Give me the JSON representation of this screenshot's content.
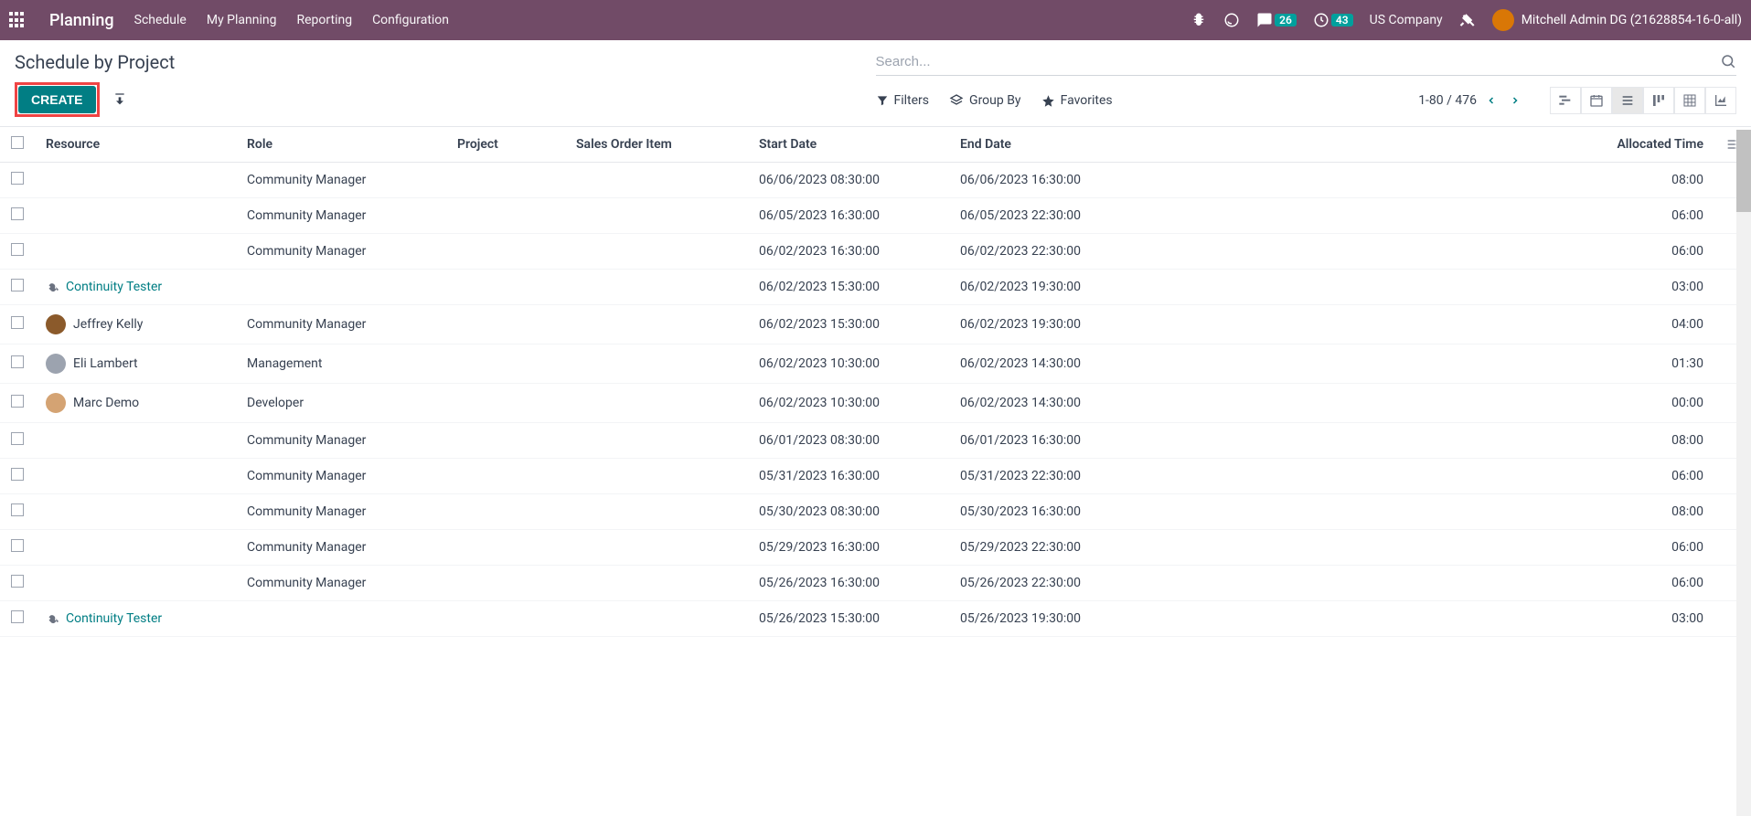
{
  "topbar": {
    "app_title": "Planning",
    "nav": [
      "Schedule",
      "My Planning",
      "Reporting",
      "Configuration"
    ],
    "msg_count": "26",
    "activity_count": "43",
    "company": "US Company",
    "user_name": "Mitchell Admin DG (21628854-16-0-all)"
  },
  "page": {
    "title": "Schedule by Project",
    "create_label": "CREATE"
  },
  "search": {
    "placeholder": "Search..."
  },
  "filters": {
    "filters": "Filters",
    "groupby": "Group By",
    "favorites": "Favorites"
  },
  "pager": {
    "range": "1-80 / 476"
  },
  "columns": {
    "resource": "Resource",
    "role": "Role",
    "project": "Project",
    "soi": "Sales Order Item",
    "start": "Start Date",
    "end": "End Date",
    "alloc": "Allocated Time"
  },
  "rows": [
    {
      "resource": "",
      "link": false,
      "avatar": false,
      "wrench": false,
      "role": "Community Manager",
      "project": "",
      "soi": "",
      "start": "06/06/2023 08:30:00",
      "end": "06/06/2023 16:30:00",
      "alloc": "08:00"
    },
    {
      "resource": "",
      "link": false,
      "avatar": false,
      "wrench": false,
      "role": "Community Manager",
      "project": "",
      "soi": "",
      "start": "06/05/2023 16:30:00",
      "end": "06/05/2023 22:30:00",
      "alloc": "06:00"
    },
    {
      "resource": "",
      "link": false,
      "avatar": false,
      "wrench": false,
      "role": "Community Manager",
      "project": "",
      "soi": "",
      "start": "06/02/2023 16:30:00",
      "end": "06/02/2023 22:30:00",
      "alloc": "06:00"
    },
    {
      "resource": "Continuity Tester",
      "link": true,
      "avatar": false,
      "wrench": true,
      "role": "",
      "project": "",
      "soi": "",
      "start": "06/02/2023 15:30:00",
      "end": "06/02/2023 19:30:00",
      "alloc": "03:00"
    },
    {
      "resource": "Jeffrey Kelly",
      "link": false,
      "avatar": true,
      "wrench": false,
      "avcolor": "#8b5a2b",
      "role": "Community Manager",
      "project": "",
      "soi": "",
      "start": "06/02/2023 15:30:00",
      "end": "06/02/2023 19:30:00",
      "alloc": "04:00"
    },
    {
      "resource": "Eli Lambert",
      "link": false,
      "avatar": true,
      "wrench": false,
      "avcolor": "#9ca3af",
      "role": "Management",
      "project": "",
      "soi": "",
      "start": "06/02/2023 10:30:00",
      "end": "06/02/2023 14:30:00",
      "alloc": "01:30"
    },
    {
      "resource": "Marc Demo",
      "link": false,
      "avatar": true,
      "wrench": false,
      "avcolor": "#d4a373",
      "role": "Developer",
      "project": "",
      "soi": "",
      "start": "06/02/2023 10:30:00",
      "end": "06/02/2023 14:30:00",
      "alloc": "00:00"
    },
    {
      "resource": "",
      "link": false,
      "avatar": false,
      "wrench": false,
      "role": "Community Manager",
      "project": "",
      "soi": "",
      "start": "06/01/2023 08:30:00",
      "end": "06/01/2023 16:30:00",
      "alloc": "08:00"
    },
    {
      "resource": "",
      "link": false,
      "avatar": false,
      "wrench": false,
      "role": "Community Manager",
      "project": "",
      "soi": "",
      "start": "05/31/2023 16:30:00",
      "end": "05/31/2023 22:30:00",
      "alloc": "06:00"
    },
    {
      "resource": "",
      "link": false,
      "avatar": false,
      "wrench": false,
      "role": "Community Manager",
      "project": "",
      "soi": "",
      "start": "05/30/2023 08:30:00",
      "end": "05/30/2023 16:30:00",
      "alloc": "08:00"
    },
    {
      "resource": "",
      "link": false,
      "avatar": false,
      "wrench": false,
      "role": "Community Manager",
      "project": "",
      "soi": "",
      "start": "05/29/2023 16:30:00",
      "end": "05/29/2023 22:30:00",
      "alloc": "06:00"
    },
    {
      "resource": "",
      "link": false,
      "avatar": false,
      "wrench": false,
      "role": "Community Manager",
      "project": "",
      "soi": "",
      "start": "05/26/2023 16:30:00",
      "end": "05/26/2023 22:30:00",
      "alloc": "06:00"
    },
    {
      "resource": "Continuity Tester",
      "link": true,
      "avatar": false,
      "wrench": true,
      "role": "",
      "project": "",
      "soi": "",
      "start": "05/26/2023 15:30:00",
      "end": "05/26/2023 19:30:00",
      "alloc": "03:00"
    }
  ]
}
